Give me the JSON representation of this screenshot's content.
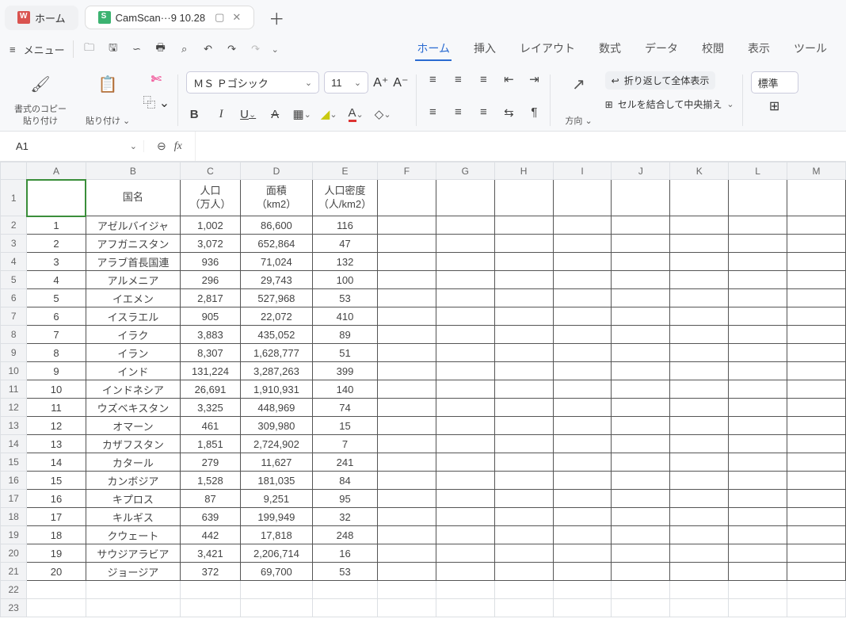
{
  "colors": {
    "accent": "#2a6bd1",
    "selection": "#3a8e3a"
  },
  "tabs": {
    "home": "ホーム",
    "doc_title": "CamScan···9 10.28",
    "plus": "＋"
  },
  "menu_label": "メニュー",
  "ribbon": {
    "home": "ホーム",
    "insert": "挿入",
    "layout": "レイアウト",
    "formula": "数式",
    "data": "データ",
    "review": "校閲",
    "view": "表示",
    "tool": "ツール"
  },
  "toolbar": {
    "copy_format1": "書式のコピー",
    "copy_format2": "貼り付け",
    "paste": "貼り付け",
    "cut": "✄",
    "font_name": "ＭＳ Ｐゴシック",
    "font_size": "11",
    "A_plus": "A⁺",
    "A_minus": "A⁻",
    "bold": "B",
    "italic": "I",
    "underline": "U",
    "strike": "A",
    "direction": "方向",
    "wrap": "折り返して全体表示",
    "merge": "セルを結合して中央揃え",
    "standard": "標準"
  },
  "name_box": "A1",
  "fx": "fx",
  "columns": [
    "A",
    "B",
    "C",
    "D",
    "E",
    "F",
    "G",
    "H",
    "I",
    "J",
    "K",
    "L",
    "M"
  ],
  "row_numbers": [
    1,
    2,
    3,
    4,
    5,
    6,
    7,
    8,
    9,
    10,
    11,
    12,
    13,
    14,
    15,
    16,
    17,
    18,
    19,
    20,
    21,
    22,
    23
  ],
  "header_row": {
    "A": "",
    "B": "国名",
    "C": "人口\n（万人）",
    "D": "面積\n（km2）",
    "E": "人口密度\n（人/km2）"
  },
  "chart_data": {
    "type": "table",
    "title": "",
    "columns": [
      "",
      "国名",
      "人口（万人）",
      "面積（km2）",
      "人口密度（人/km2）"
    ],
    "rows": [
      [
        "1",
        "アゼルバイジャ",
        "1,002",
        "86,600",
        "116"
      ],
      [
        "2",
        "アフガニスタン",
        "3,072",
        "652,864",
        "47"
      ],
      [
        "3",
        "アラブ首長国連",
        "936",
        "71,024",
        "132"
      ],
      [
        "4",
        "アルメニア",
        "296",
        "29,743",
        "100"
      ],
      [
        "5",
        "イエメン",
        "2,817",
        "527,968",
        "53"
      ],
      [
        "6",
        "イスラエル",
        "905",
        "22,072",
        "410"
      ],
      [
        "7",
        "イラク",
        "3,883",
        "435,052",
        "89"
      ],
      [
        "8",
        "イラン",
        "8,307",
        "1,628,777",
        "51"
      ],
      [
        "9",
        "インド",
        "131,224",
        "3,287,263",
        "399"
      ],
      [
        "10",
        "インドネシア",
        "26,691",
        "1,910,931",
        "140"
      ],
      [
        "11",
        "ウズベキスタン",
        "3,325",
        "448,969",
        "74"
      ],
      [
        "12",
        "オマーン",
        "461",
        "309,980",
        "15"
      ],
      [
        "13",
        "カザフスタン",
        "1,851",
        "2,724,902",
        "7"
      ],
      [
        "14",
        "カタール",
        "279",
        "11,627",
        "241"
      ],
      [
        "15",
        "カンボジア",
        "1,528",
        "181,035",
        "84"
      ],
      [
        "16",
        "キプロス",
        "87",
        "9,251",
        "95"
      ],
      [
        "17",
        "キルギス",
        "639",
        "199,949",
        "32"
      ],
      [
        "18",
        "クウェート",
        "442",
        "17,818",
        "248"
      ],
      [
        "19",
        "サウジアラビア",
        "3,421",
        "2,206,714",
        "16"
      ],
      [
        "20",
        "ジョージア",
        "372",
        "69,700",
        "53"
      ]
    ]
  }
}
